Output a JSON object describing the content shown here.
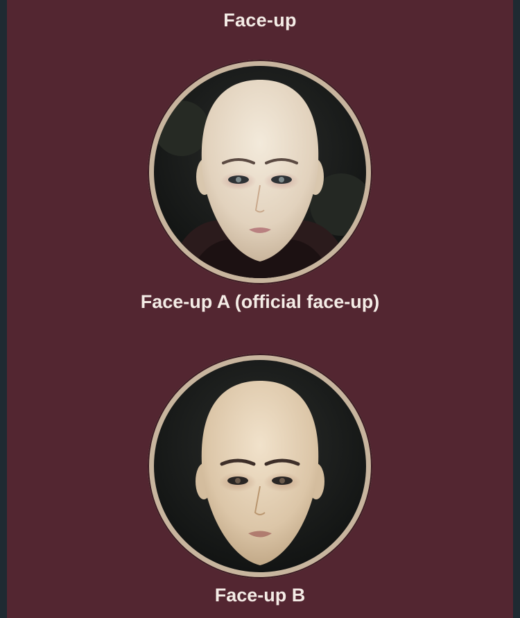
{
  "header": {
    "title": "Face-up"
  },
  "faceups": [
    {
      "caption": "Face-up A (official face-up)"
    },
    {
      "caption": "Face-up B"
    }
  ],
  "colors": {
    "background": "#532631",
    "side_strip": "#1f2a32",
    "ring": "#c8b59e",
    "text": "#f4ece6"
  }
}
